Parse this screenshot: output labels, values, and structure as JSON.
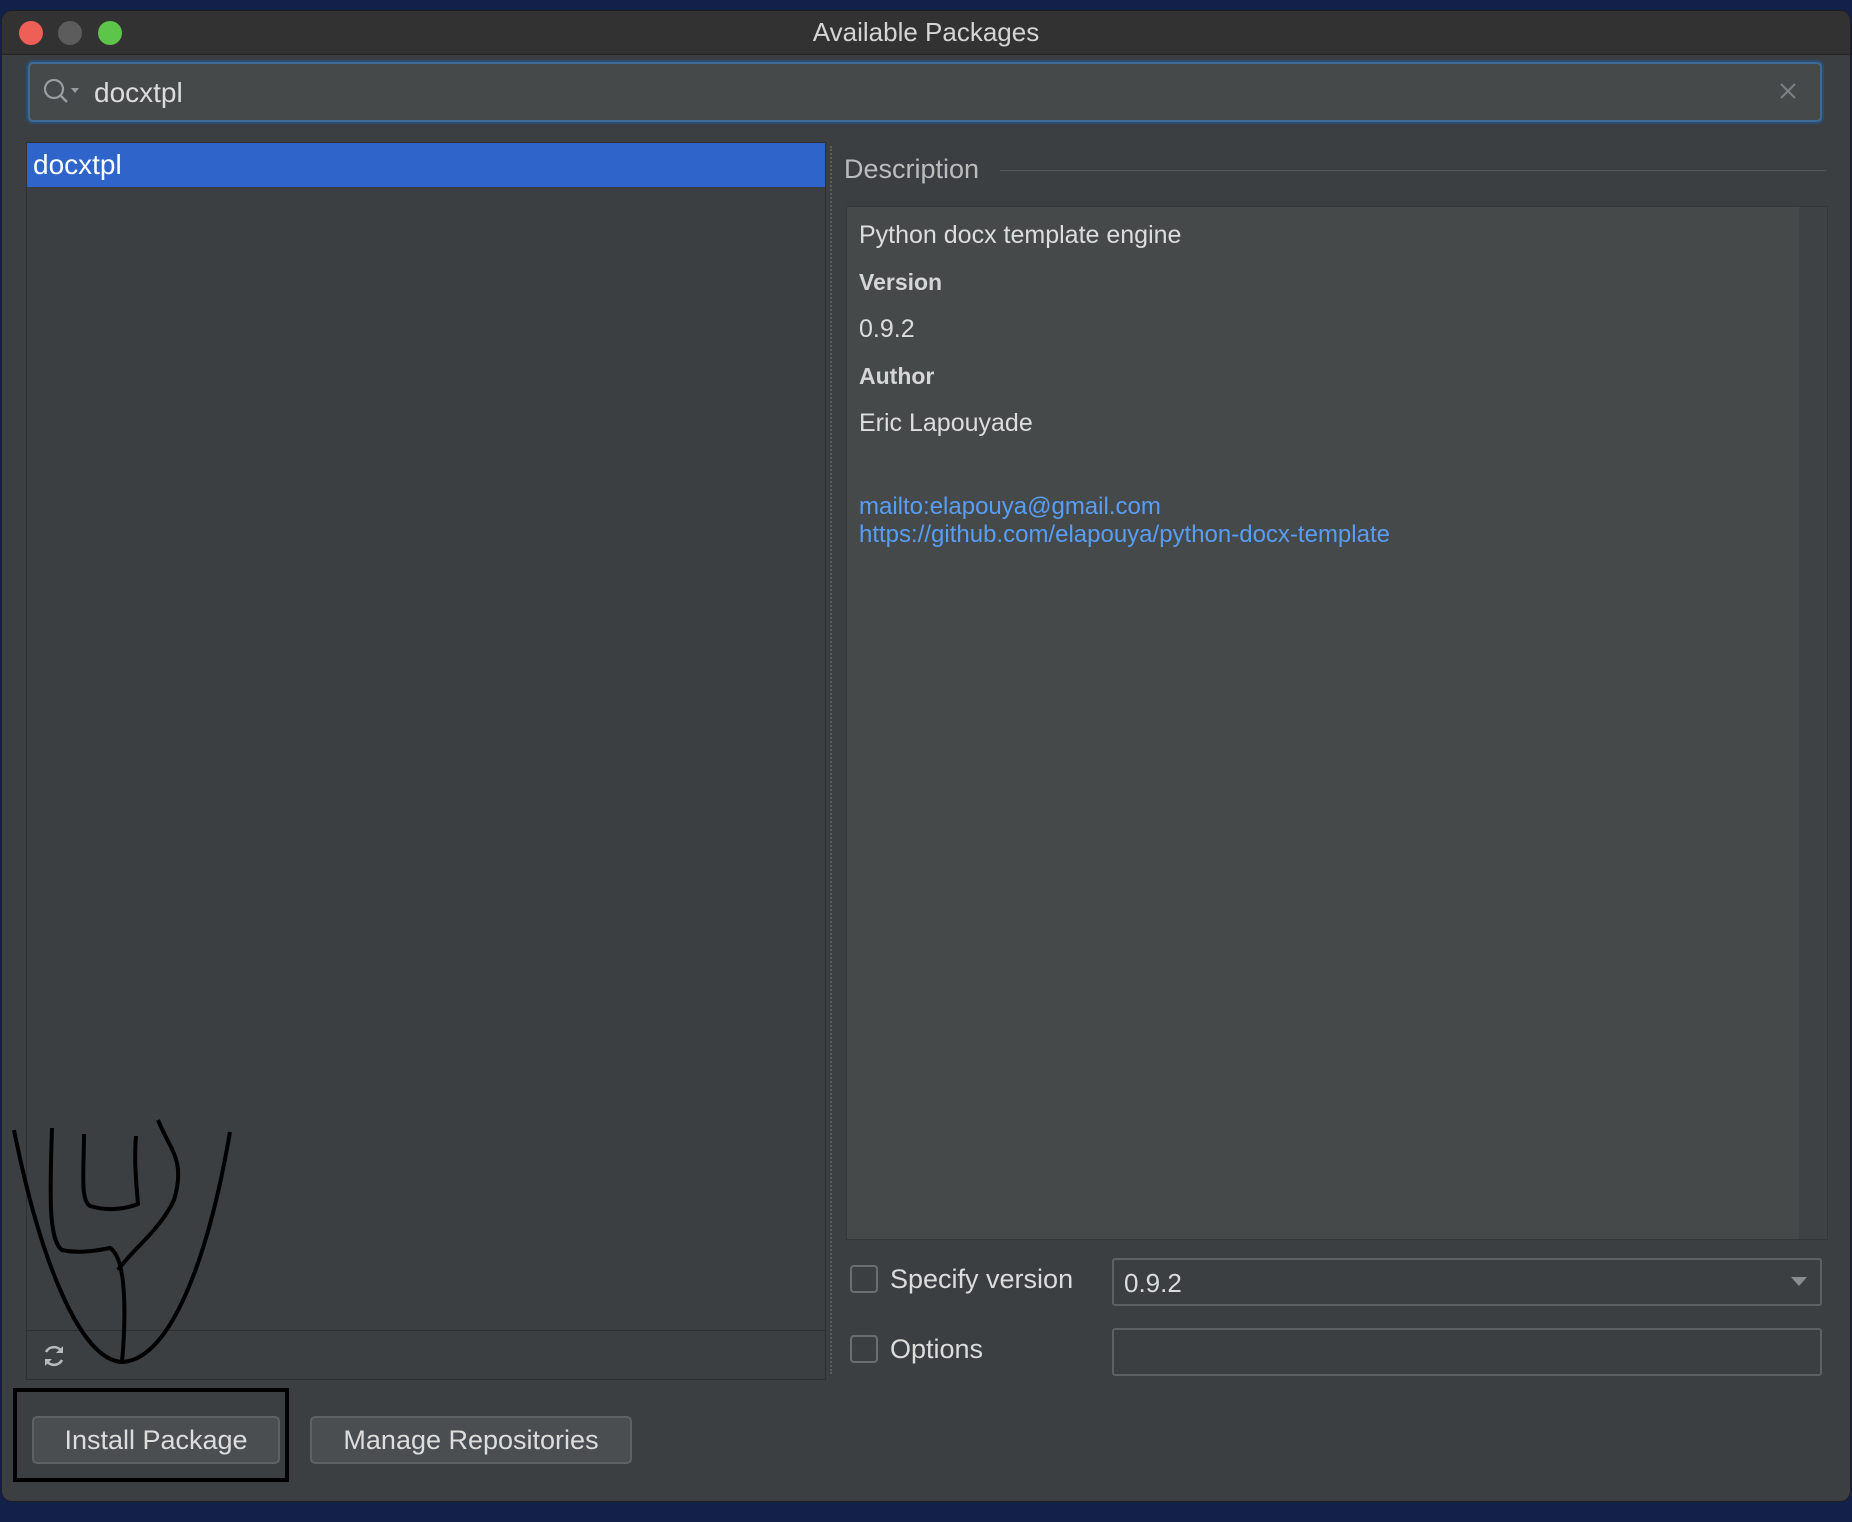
{
  "window": {
    "title": "Available Packages"
  },
  "search": {
    "value": "docxtpl"
  },
  "package_list": {
    "items": [
      {
        "name": "docxtpl"
      }
    ]
  },
  "description": {
    "header": "Description",
    "summary": "Python docx template engine",
    "version_label": "Version",
    "version_value": "0.9.2",
    "author_label": "Author",
    "author_value": "Eric Lapouyade",
    "links": [
      "mailto:elapouya@gmail.com",
      "https://github.com/elapouya/python-docx-template"
    ]
  },
  "options": {
    "specify_version_label": "Specify version",
    "specify_version_checked": false,
    "version_select_value": "0.9.2",
    "options_label": "Options",
    "options_checked": false,
    "options_value": ""
  },
  "buttons": {
    "install": "Install Package",
    "manage": "Manage Repositories"
  },
  "colors": {
    "selection": "#2f65ca",
    "link": "#589df6",
    "background": "#3c3f41"
  },
  "icons": [
    "search-icon",
    "clear-icon",
    "refresh-icon",
    "dropdown-arrow-icon"
  ]
}
